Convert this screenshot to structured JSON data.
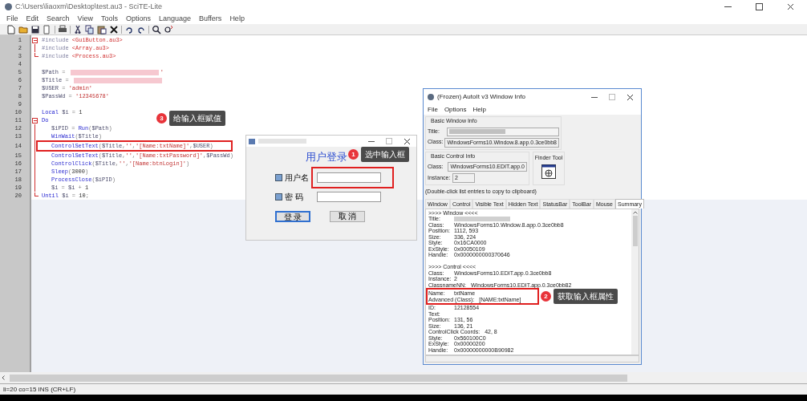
{
  "window": {
    "title": "C:\\Users\\liaoxm\\Desktop\\test.au3 - SciTE-Lite"
  },
  "menu": [
    "File",
    "Edit",
    "Search",
    "View",
    "Tools",
    "Options",
    "Language",
    "Buffers",
    "Help"
  ],
  "editor": {
    "lines": [
      {
        "number": "1",
        "fold_start": true,
        "fold_line": false,
        "fold_end": false,
        "indented": false,
        "highlighted": false,
        "segments": [
          {
            "kind": "directive",
            "text": "#include "
          },
          {
            "kind": "include",
            "text": "<GuiButton.au3>"
          }
        ]
      },
      {
        "number": "2",
        "fold_start": false,
        "fold_line": true,
        "fold_end": false,
        "indented": false,
        "highlighted": false,
        "segments": [
          {
            "kind": "directive",
            "text": "#include "
          },
          {
            "kind": "include",
            "text": "<Array.au3>"
          }
        ]
      },
      {
        "number": "3",
        "fold_start": false,
        "fold_line": false,
        "fold_end": true,
        "indented": false,
        "highlighted": false,
        "segments": [
          {
            "kind": "directive",
            "text": "#include "
          },
          {
            "kind": "include",
            "text": "<Process.au3>"
          }
        ]
      },
      {
        "number": "4",
        "fold_start": false,
        "fold_line": false,
        "fold_end": false,
        "indented": false,
        "highlighted": false
      },
      {
        "number": "5",
        "fold_start": false,
        "fold_line": false,
        "fold_end": false,
        "indented": false,
        "highlighted": false,
        "segments": [
          {
            "kind": "variable",
            "text": "$Path"
          },
          {
            "kind": "operator",
            "text": " = "
          },
          {
            "kind": "redacted"
          },
          {
            "kind": "string",
            "text": "'"
          }
        ]
      },
      {
        "number": "6",
        "fold_start": false,
        "fold_line": false,
        "fold_end": false,
        "indented": false,
        "highlighted": false,
        "segments": [
          {
            "kind": "variable",
            "text": "$Title"
          },
          {
            "kind": "operator",
            "text": " = "
          },
          {
            "kind": "redacted"
          }
        ]
      },
      {
        "number": "7",
        "fold_start": false,
        "fold_line": false,
        "fold_end": false,
        "indented": false,
        "highlighted": false,
        "segments": [
          {
            "kind": "variable",
            "text": "$USER"
          },
          {
            "kind": "operator",
            "text": " = "
          },
          {
            "kind": "string",
            "text": "'admin'"
          }
        ]
      },
      {
        "number": "8",
        "fold_start": false,
        "fold_line": false,
        "fold_end": false,
        "indented": false,
        "highlighted": false,
        "segments": [
          {
            "kind": "variable",
            "text": "$PassWd"
          },
          {
            "kind": "operator",
            "text": " = "
          },
          {
            "kind": "string",
            "text": "'12345678'"
          }
        ]
      },
      {
        "number": "9",
        "fold_start": false,
        "fold_line": false,
        "fold_end": false,
        "indented": false,
        "highlighted": false
      },
      {
        "number": "10",
        "fold_start": false,
        "fold_line": false,
        "fold_end": false,
        "indented": false,
        "highlighted": false,
        "segments": [
          {
            "kind": "keyword",
            "text": "Local "
          },
          {
            "kind": "variable",
            "text": "$i"
          },
          {
            "kind": "operator",
            "text": " = "
          },
          {
            "kind": "number",
            "text": "1"
          }
        ]
      },
      {
        "number": "11",
        "fold_start": true,
        "fold_line": false,
        "fold_end": false,
        "indented": false,
        "highlighted": false,
        "segments": [
          {
            "kind": "keyword",
            "text": "Do"
          }
        ]
      },
      {
        "number": "12",
        "fold_start": false,
        "fold_line": true,
        "fold_end": false,
        "indented": true,
        "highlighted": false,
        "segments": [
          {
            "kind": "variable",
            "text": "$iPID"
          },
          {
            "kind": "operator",
            "text": " = "
          },
          {
            "kind": "function",
            "text": "Run"
          },
          {
            "kind": "operator",
            "text": "("
          },
          {
            "kind": "variable",
            "text": "$Path"
          },
          {
            "kind": "operator",
            "text": ")"
          }
        ]
      },
      {
        "number": "13",
        "fold_start": false,
        "fold_line": true,
        "fold_end": false,
        "indented": true,
        "highlighted": false,
        "segments": [
          {
            "kind": "function",
            "text": "WinWait"
          },
          {
            "kind": "operator",
            "text": "("
          },
          {
            "kind": "variable",
            "text": "$Title"
          },
          {
            "kind": "operator",
            "text": ")"
          }
        ]
      },
      {
        "number": "14",
        "fold_start": false,
        "fold_line": true,
        "fold_end": false,
        "indented": true,
        "highlighted": true,
        "segments": [
          {
            "kind": "function",
            "text": "ControlSetText"
          },
          {
            "kind": "operator",
            "text": "("
          },
          {
            "kind": "variable",
            "text": "$Title"
          },
          {
            "kind": "operator",
            "text": ","
          },
          {
            "kind": "string",
            "text": "''"
          },
          {
            "kind": "operator",
            "text": ","
          },
          {
            "kind": "string",
            "text": "'[Name:txtName]'"
          },
          {
            "kind": "operator",
            "text": ","
          },
          {
            "kind": "variable",
            "text": "$USER"
          },
          {
            "kind": "operator",
            "text": ")"
          }
        ]
      },
      {
        "number": "15",
        "fold_start": false,
        "fold_line": true,
        "fold_end": false,
        "indented": true,
        "highlighted": false,
        "segments": [
          {
            "kind": "function",
            "text": "ControlSetText"
          },
          {
            "kind": "operator",
            "text": "("
          },
          {
            "kind": "variable",
            "text": "$Title"
          },
          {
            "kind": "operator",
            "text": ","
          },
          {
            "kind": "string",
            "text": "''"
          },
          {
            "kind": "operator",
            "text": ","
          },
          {
            "kind": "string",
            "text": "'[Name:txtPassword]'"
          },
          {
            "kind": "operator",
            "text": ","
          },
          {
            "kind": "variable",
            "text": "$PassWd"
          },
          {
            "kind": "operator",
            "text": ")"
          }
        ]
      },
      {
        "number": "16",
        "fold_start": false,
        "fold_line": true,
        "fold_end": false,
        "indented": true,
        "highlighted": false,
        "segments": [
          {
            "kind": "function",
            "text": "ControlClick"
          },
          {
            "kind": "operator",
            "text": "("
          },
          {
            "kind": "variable",
            "text": "$Title"
          },
          {
            "kind": "operator",
            "text": ","
          },
          {
            "kind": "string",
            "text": "''"
          },
          {
            "kind": "operator",
            "text": ","
          },
          {
            "kind": "string",
            "text": "'[Name:btnLogin]'"
          },
          {
            "kind": "operator",
            "text": ")"
          }
        ]
      },
      {
        "number": "17",
        "fold_start": false,
        "fold_line": true,
        "fold_end": false,
        "indented": true,
        "highlighted": false,
        "segments": [
          {
            "kind": "function",
            "text": "Sleep"
          },
          {
            "kind": "operator",
            "text": "("
          },
          {
            "kind": "number",
            "text": "3000"
          },
          {
            "kind": "operator",
            "text": ")"
          }
        ]
      },
      {
        "number": "18",
        "fold_start": false,
        "fold_line": true,
        "fold_end": false,
        "indented": true,
        "highlighted": false,
        "segments": [
          {
            "kind": "function",
            "text": "ProcessClose"
          },
          {
            "kind": "operator",
            "text": "("
          },
          {
            "kind": "variable",
            "text": "$iPID"
          },
          {
            "kind": "operator",
            "text": ")"
          }
        ]
      },
      {
        "number": "19",
        "fold_start": false,
        "fold_line": true,
        "fold_end": false,
        "indented": true,
        "highlighted": false,
        "segments": [
          {
            "kind": "variable",
            "text": "$i"
          },
          {
            "kind": "operator",
            "text": " = "
          },
          {
            "kind": "variable",
            "text": "$i"
          },
          {
            "kind": "operator",
            "text": " + "
          },
          {
            "kind": "number",
            "text": "1"
          }
        ]
      },
      {
        "number": "20",
        "fold_start": false,
        "fold_line": false,
        "fold_end": true,
        "indented": false,
        "highlighted": false,
        "segments": [
          {
            "kind": "keyword",
            "text": "Until "
          },
          {
            "kind": "variable",
            "text": "$i"
          },
          {
            "kind": "operator",
            "text": " = "
          },
          {
            "kind": "number",
            "text": "10"
          },
          {
            "kind": "operator",
            "text": ";"
          }
        ]
      }
    ]
  },
  "login_dialog": {
    "heading": "用户登录",
    "fields": [
      {
        "label": "用户名",
        "highlighted": true
      },
      {
        "label": "密 码",
        "highlighted": false
      }
    ],
    "buttons": [
      {
        "label": "登 录",
        "focused": true
      },
      {
        "label": "取 消",
        "focused": false
      }
    ]
  },
  "info_window": {
    "title": "(Frozen) AutoIt v3 Window Info",
    "menu": [
      "File",
      "Options",
      "Help"
    ],
    "basic_window": {
      "legend": "Basic Window Info",
      "fields": [
        {
          "label": "Title:",
          "kind": "redacted"
        },
        {
          "label": "Class:",
          "kind": "text",
          "value": "WindowsForms10.Window.8.app.0.3ce0bb8"
        }
      ]
    },
    "basic_control": {
      "legend": "Basic Control Info",
      "fields": [
        {
          "label": "Class:",
          "kind": "text",
          "value": "WindowsForms10.EDIT.app.0"
        },
        {
          "label": "Instance:",
          "kind": "text",
          "value": "2"
        }
      ]
    },
    "finder_tool": {
      "label": "Finder Tool"
    },
    "hint": "(Double-click list entries to copy to clipboard)",
    "tabs": [
      {
        "label": "Window",
        "selected": false
      },
      {
        "label": "Control",
        "selected": false
      },
      {
        "label": "Visible Text",
        "selected": false
      },
      {
        "label": "Hidden Text",
        "selected": false
      },
      {
        "label": "StatusBar",
        "selected": false
      },
      {
        "label": "ToolBar",
        "selected": false
      },
      {
        "label": "Mouse",
        "selected": false
      },
      {
        "label": "Summary",
        "selected": true
      }
    ],
    "summary": [
      {
        "kind": "header",
        "label": ">>>> Window <<<<",
        "highlighted": false
      },
      {
        "kind": "redacted",
        "label": "Title:",
        "highlighted": false
      },
      {
        "kind": "field",
        "label": "Class:",
        "value": "WindowsForms10.Window.8.app.0.3ce0bb8",
        "highlighted": false
      },
      {
        "kind": "field",
        "label": "Position:",
        "value": "1112, 593",
        "highlighted": false
      },
      {
        "kind": "field",
        "label": "Size:",
        "value": "336, 224",
        "highlighted": false
      },
      {
        "kind": "field",
        "label": "Style:",
        "value": "0x16CA0000",
        "highlighted": false
      },
      {
        "kind": "field",
        "label": "ExStyle:",
        "value": "0x00050109",
        "highlighted": false
      },
      {
        "kind": "field",
        "label": "Handle:",
        "value": "0x0000000000370646",
        "highlighted": false
      },
      {
        "kind": "blank",
        "highlighted": false
      },
      {
        "kind": "header",
        "label": ">>>> Control <<<<",
        "highlighted": false
      },
      {
        "kind": "field",
        "label": "Class:",
        "value": "WindowsForms10.EDIT.app.0.3ce0bb8",
        "highlighted": false
      },
      {
        "kind": "field",
        "label": "Instance:",
        "value": "2",
        "highlighted": false
      },
      {
        "kind": "wide",
        "label": "ClassnameNN:",
        "value": "WindowsForms10.EDIT.app.0.3ce0bb82",
        "highlighted": false
      },
      {
        "kind": "field",
        "label": "Name:",
        "value": "txtName",
        "highlighted": true
      },
      {
        "kind": "wide",
        "label": "Advanced (Class):",
        "value": "[NAME:txtName]",
        "highlighted": true
      },
      {
        "kind": "field",
        "label": "ID:",
        "value": "12128554",
        "highlighted": false
      },
      {
        "kind": "field",
        "label": "Text:",
        "highlighted": false
      },
      {
        "kind": "field",
        "label": "Position:",
        "value": "131, 56",
        "highlighted": false
      },
      {
        "kind": "field",
        "label": "Size:",
        "value": "136, 21",
        "highlighted": false
      },
      {
        "kind": "wide",
        "label": "ControlClick Coords:",
        "value": "42, 8",
        "highlighted": false
      },
      {
        "kind": "field",
        "label": "Style:",
        "value": "0x560100C0",
        "highlighted": false
      },
      {
        "kind": "field",
        "label": "ExStyle:",
        "value": "0x00000200",
        "highlighted": false
      },
      {
        "kind": "field",
        "label": "Handle:",
        "value": "0x00000000000B90982",
        "highlighted": false
      }
    ]
  },
  "callouts": [
    {
      "number": "3",
      "text": "给输入框赋值"
    },
    {
      "number": "1",
      "text": "选中输入框"
    },
    {
      "number": "2",
      "text": "获取输入框属性"
    }
  ],
  "status_bar": "li=20 co=15 INS (CR+LF)"
}
